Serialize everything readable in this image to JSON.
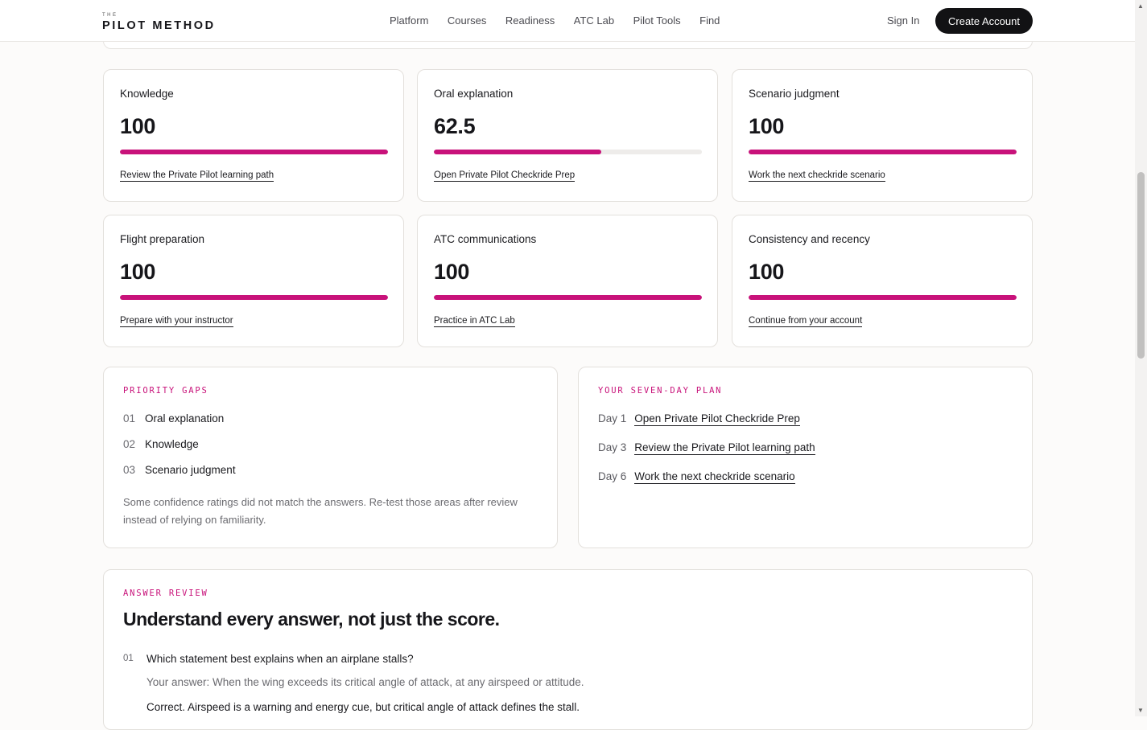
{
  "header": {
    "logo_small": "THE",
    "logo_main": "PILOT METHOD",
    "nav": [
      "Platform",
      "Courses",
      "Readiness",
      "ATC Lab",
      "Pilot Tools",
      "Find"
    ],
    "sign_in": "Sign In",
    "create_account": "Create Account"
  },
  "accent_color": "#c8127a",
  "scores": [
    {
      "title": "Knowledge",
      "value": "100",
      "fill": 1.0,
      "link": "Review the Private Pilot learning path"
    },
    {
      "title": "Oral explanation",
      "value": "62.5",
      "fill": 0.625,
      "link": "Open Private Pilot Checkride Prep"
    },
    {
      "title": "Scenario judgment",
      "value": "100",
      "fill": 1.0,
      "link": "Work the next checkride scenario"
    },
    {
      "title": "Flight preparation",
      "value": "100",
      "fill": 1.0,
      "link": "Prepare with your instructor"
    },
    {
      "title": "ATC communications",
      "value": "100",
      "fill": 1.0,
      "link": "Practice in ATC Lab"
    },
    {
      "title": "Consistency and recency",
      "value": "100",
      "fill": 1.0,
      "link": "Continue from your account"
    }
  ],
  "priority_gaps": {
    "eyebrow": "PRIORITY GAPS",
    "items": [
      {
        "num": "01",
        "label": "Oral explanation"
      },
      {
        "num": "02",
        "label": "Knowledge"
      },
      {
        "num": "03",
        "label": "Scenario judgment"
      }
    ],
    "note": "Some confidence ratings did not match the answers. Re-test those areas after review instead of relying on familiarity."
  },
  "seven_day_plan": {
    "eyebrow": "YOUR SEVEN-DAY PLAN",
    "items": [
      {
        "day": "Day 1",
        "link": "Open Private Pilot Checkride Prep"
      },
      {
        "day": "Day 3",
        "link": "Review the Private Pilot learning path"
      },
      {
        "day": "Day 6",
        "link": "Work the next checkride scenario"
      }
    ]
  },
  "answer_review": {
    "eyebrow": "ANSWER REVIEW",
    "heading": "Understand every answer, not just the score.",
    "questions": [
      {
        "num": "01",
        "question": "Which statement best explains when an airplane stalls?",
        "your_answer": "Your answer: When the wing exceeds its critical angle of attack, at any airspeed or attitude.",
        "feedback": "Correct. Airspeed is a warning and energy cue, but critical angle of attack defines the stall."
      }
    ]
  }
}
